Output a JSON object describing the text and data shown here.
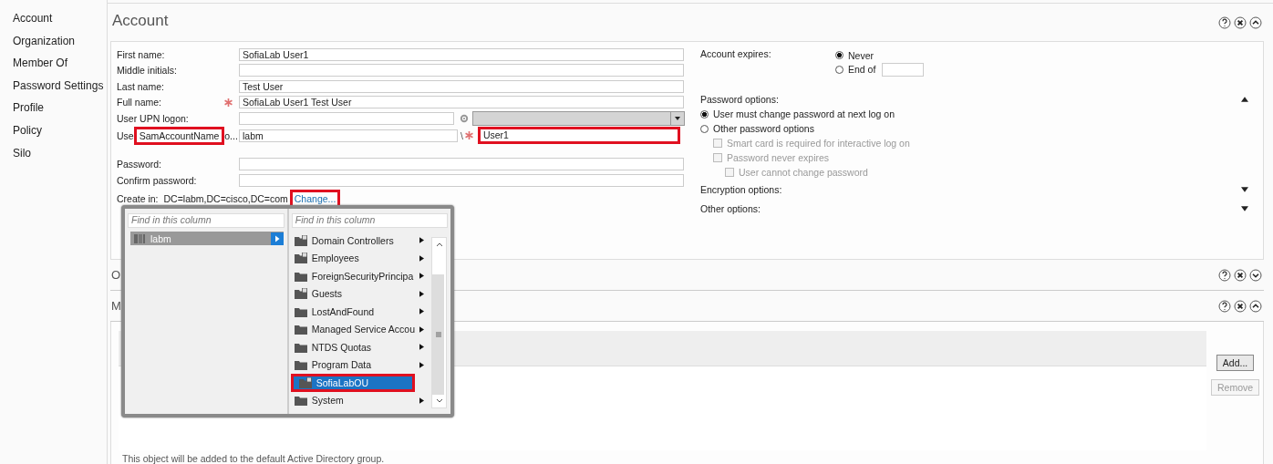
{
  "sidebar": {
    "items": [
      {
        "label": "Account"
      },
      {
        "label": "Organization"
      },
      {
        "label": "Member Of"
      },
      {
        "label": "Password Settings"
      },
      {
        "label": "Profile"
      },
      {
        "label": "Policy"
      },
      {
        "label": "Silo"
      }
    ]
  },
  "account": {
    "title": "Account",
    "expanded": true,
    "fields": [
      {
        "kind": "text",
        "label": "First name:",
        "value": "SofiaLab User1"
      },
      {
        "kind": "text",
        "label": "Middle initials:"
      },
      {
        "kind": "text",
        "label": "Last name:",
        "value": "Test User"
      },
      {
        "kind": "text",
        "label": "Full name:",
        "value": "SofiaLab User1 Test User",
        "required": true
      },
      {
        "kind": "upn",
        "label": "User UPN logon:"
      },
      {
        "kind": "sam",
        "label_parts": [
          "Use",
          "SamAccountName",
          "o..."
        ],
        "label_highlighted": true,
        "domain": "labm",
        "separator": "\\",
        "required": true,
        "value": "User1",
        "value_highlighted": true
      },
      {
        "kind": "password",
        "label": "Password:"
      },
      {
        "kind": "password",
        "label": "Confirm password:"
      }
    ],
    "create_in": {
      "label": "Create in:",
      "value": "DC=labm,DC=cisco,DC=com",
      "link": "Change...",
      "link_highlighted": true
    },
    "account_expires": {
      "label": "Account expires:",
      "options": [
        {
          "label": "Never",
          "selected": true
        },
        {
          "label": "End of",
          "selected": false
        }
      ]
    },
    "password_options": {
      "label": "Password options:",
      "expanded": true,
      "options": [
        {
          "label": "User must change password at next log on",
          "selected": true
        },
        {
          "label": "Other password options",
          "selected": false
        }
      ],
      "checkboxes": [
        {
          "label": "Smart card is required for interactive log on",
          "checked": false,
          "disabled": true
        },
        {
          "label": "Password never expires",
          "checked": false,
          "disabled": true,
          "children": [
            {
              "label": "User cannot change password",
              "checked": false,
              "disabled": true
            }
          ]
        }
      ]
    },
    "collapsed_groups": [
      {
        "label": "Encryption options:",
        "expanded": false
      },
      {
        "label": "Other options:",
        "expanded": false
      }
    ]
  },
  "organization": {
    "title": "O",
    "expanded": false
  },
  "member_of": {
    "title": "M",
    "expanded": true,
    "note": "This object will be added to the default Active Directory group.",
    "buttons": [
      {
        "label": "Add...",
        "disabled": false
      },
      {
        "label": "Remove",
        "disabled": true
      }
    ]
  },
  "picker": {
    "columns": [
      {
        "placeholder": "Find in this column",
        "items": [
          {
            "label": "labm",
            "kind": "domain",
            "selected": false,
            "in_path": true,
            "has_children": true
          }
        ]
      },
      {
        "placeholder": "Find in this column",
        "items": [
          {
            "label": "Domain Controllers",
            "kind": "ou",
            "selected": false,
            "has_children": true
          },
          {
            "label": "Employees",
            "kind": "ou",
            "selected": false,
            "has_children": true
          },
          {
            "label": "ForeignSecurityPrincipa",
            "kind": "container",
            "selected": false,
            "has_children": true
          },
          {
            "label": "Guests",
            "kind": "ou",
            "selected": false,
            "has_children": true
          },
          {
            "label": "LostAndFound",
            "kind": "container",
            "selected": false,
            "has_children": true
          },
          {
            "label": "Managed Service Accou",
            "kind": "container",
            "selected": false,
            "has_children": true
          },
          {
            "label": "NTDS Quotas",
            "kind": "container",
            "selected": false,
            "has_children": true
          },
          {
            "label": "Program Data",
            "kind": "container",
            "selected": false,
            "has_children": true
          },
          {
            "label": "SofiaLabOU",
            "kind": "ou",
            "selected": true,
            "highlighted": true
          },
          {
            "label": "System",
            "kind": "container",
            "selected": false,
            "has_children": true
          }
        ]
      }
    ]
  }
}
